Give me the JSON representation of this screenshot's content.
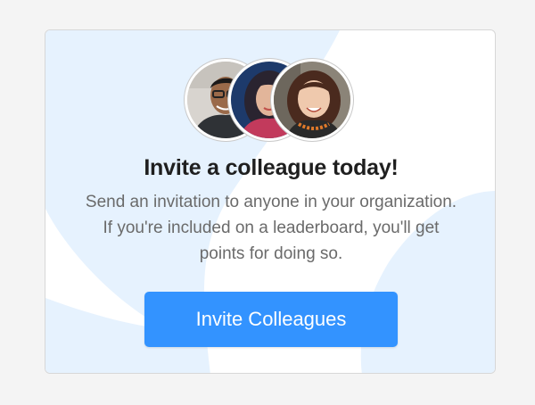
{
  "invite_card": {
    "title": "Invite a colleague today!",
    "description": "Send an invitation to anyone in your organization. If you're included on a leaderboard, you'll get points for doing so.",
    "button_label": "Invite Colleagues",
    "avatars": [
      {
        "icon": "person-avatar-1"
      },
      {
        "icon": "person-avatar-2"
      },
      {
        "icon": "person-avatar-3"
      }
    ]
  },
  "colors": {
    "page_background": "#f4f4f4",
    "card_background": "#ffffff",
    "decor_blue": "#e6f2fe",
    "button_background": "#3393ff",
    "button_text": "#ffffff",
    "title_text": "#1f1f1f",
    "body_text": "#6a6a6a"
  }
}
